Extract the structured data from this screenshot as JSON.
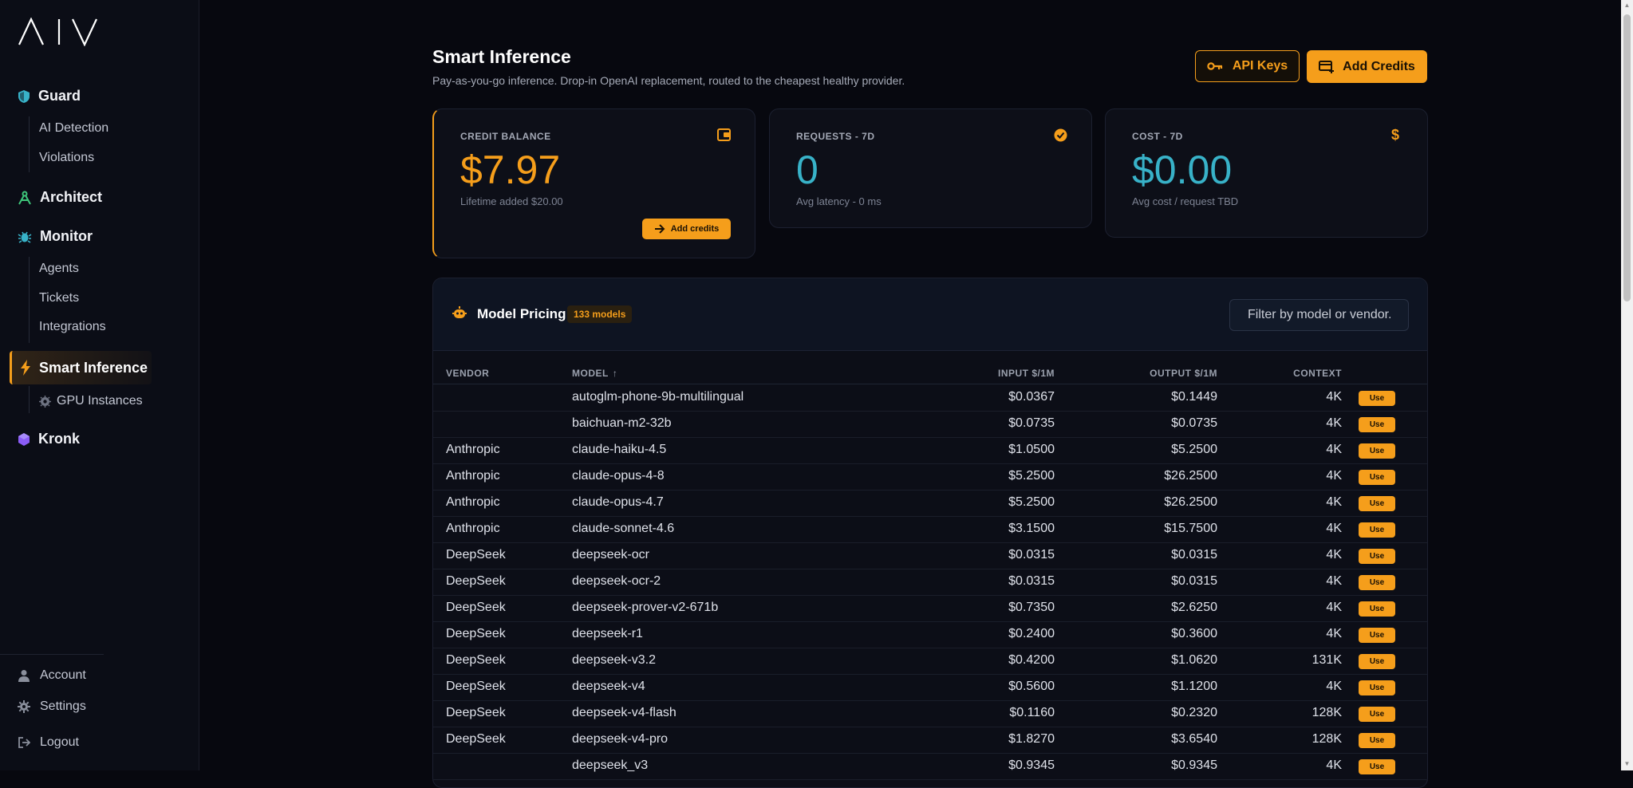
{
  "sidebar": {
    "logo_text": "AIV",
    "sections": {
      "guard": {
        "label": "Guard",
        "items": [
          "AI Detection",
          "Violations"
        ]
      },
      "architect": {
        "label": "Architect"
      },
      "monitor": {
        "label": "Monitor",
        "items": [
          "Agents",
          "Tickets",
          "Integrations"
        ]
      },
      "smart_inference": {
        "label": "Smart Inference",
        "items": [
          "GPU Instances"
        ]
      },
      "kronk": {
        "label": "Kronk"
      }
    },
    "bottom": {
      "account": "Account",
      "settings": "Settings",
      "logout": "Logout"
    }
  },
  "header": {
    "title": "Smart Inference",
    "subtitle": "Pay-as-you-go inference. Drop-in OpenAI replacement, routed to the cheapest healthy provider.",
    "api_keys_label": "API Keys",
    "add_credits_label": "Add Credits"
  },
  "cards": {
    "credit": {
      "label": "CREDIT BALANCE",
      "value": "$7.97",
      "note": "Lifetime added $20.00",
      "button": "Add credits"
    },
    "requests": {
      "label": "REQUESTS - 7D",
      "value": "0",
      "note": "Avg latency - 0 ms"
    },
    "cost": {
      "label": "COST - 7D",
      "value": "$0.00",
      "note": "Avg cost / request TBD"
    }
  },
  "pricing": {
    "title": "Model Pricing",
    "count_badge": "133 models",
    "filter_placeholder": "Filter by model or vendor...",
    "columns": {
      "vendor": "VENDOR",
      "model": "MODEL",
      "sort_arrow": "↑",
      "input": "INPUT $/1M",
      "output": "OUTPUT $/1M",
      "context": "CONTEXT"
    },
    "use_label": "Use",
    "rows": [
      {
        "vendor": "",
        "model": "autoglm-phone-9b-multilingual",
        "input": "$0.0367",
        "output": "$0.1449",
        "context": "4K"
      },
      {
        "vendor": "",
        "model": "baichuan-m2-32b",
        "input": "$0.0735",
        "output": "$0.0735",
        "context": "4K"
      },
      {
        "vendor": "Anthropic",
        "model": "claude-haiku-4.5",
        "input": "$1.0500",
        "output": "$5.2500",
        "context": "4K"
      },
      {
        "vendor": "Anthropic",
        "model": "claude-opus-4-8",
        "input": "$5.2500",
        "output": "$26.2500",
        "context": "4K"
      },
      {
        "vendor": "Anthropic",
        "model": "claude-opus-4.7",
        "input": "$5.2500",
        "output": "$26.2500",
        "context": "4K"
      },
      {
        "vendor": "Anthropic",
        "model": "claude-sonnet-4.6",
        "input": "$3.1500",
        "output": "$15.7500",
        "context": "4K"
      },
      {
        "vendor": "DeepSeek",
        "model": "deepseek-ocr",
        "input": "$0.0315",
        "output": "$0.0315",
        "context": "4K"
      },
      {
        "vendor": "DeepSeek",
        "model": "deepseek-ocr-2",
        "input": "$0.0315",
        "output": "$0.0315",
        "context": "4K"
      },
      {
        "vendor": "DeepSeek",
        "model": "deepseek-prover-v2-671b",
        "input": "$0.7350",
        "output": "$2.6250",
        "context": "4K"
      },
      {
        "vendor": "DeepSeek",
        "model": "deepseek-r1",
        "input": "$0.2400",
        "output": "$0.3600",
        "context": "4K"
      },
      {
        "vendor": "DeepSeek",
        "model": "deepseek-v3.2",
        "input": "$0.4200",
        "output": "$1.0620",
        "context": "131K"
      },
      {
        "vendor": "DeepSeek",
        "model": "deepseek-v4",
        "input": "$0.5600",
        "output": "$1.1200",
        "context": "4K"
      },
      {
        "vendor": "DeepSeek",
        "model": "deepseek-v4-flash",
        "input": "$0.1160",
        "output": "$0.2320",
        "context": "128K"
      },
      {
        "vendor": "DeepSeek",
        "model": "deepseek-v4-pro",
        "input": "$1.8270",
        "output": "$3.6540",
        "context": "128K"
      },
      {
        "vendor": "",
        "model": "deepseek_v3",
        "input": "$0.9345",
        "output": "$0.9345",
        "context": "4K"
      }
    ]
  },
  "colors": {
    "accent": "#f59e1b",
    "teal": "#38b2c8",
    "background": "#07080f"
  }
}
